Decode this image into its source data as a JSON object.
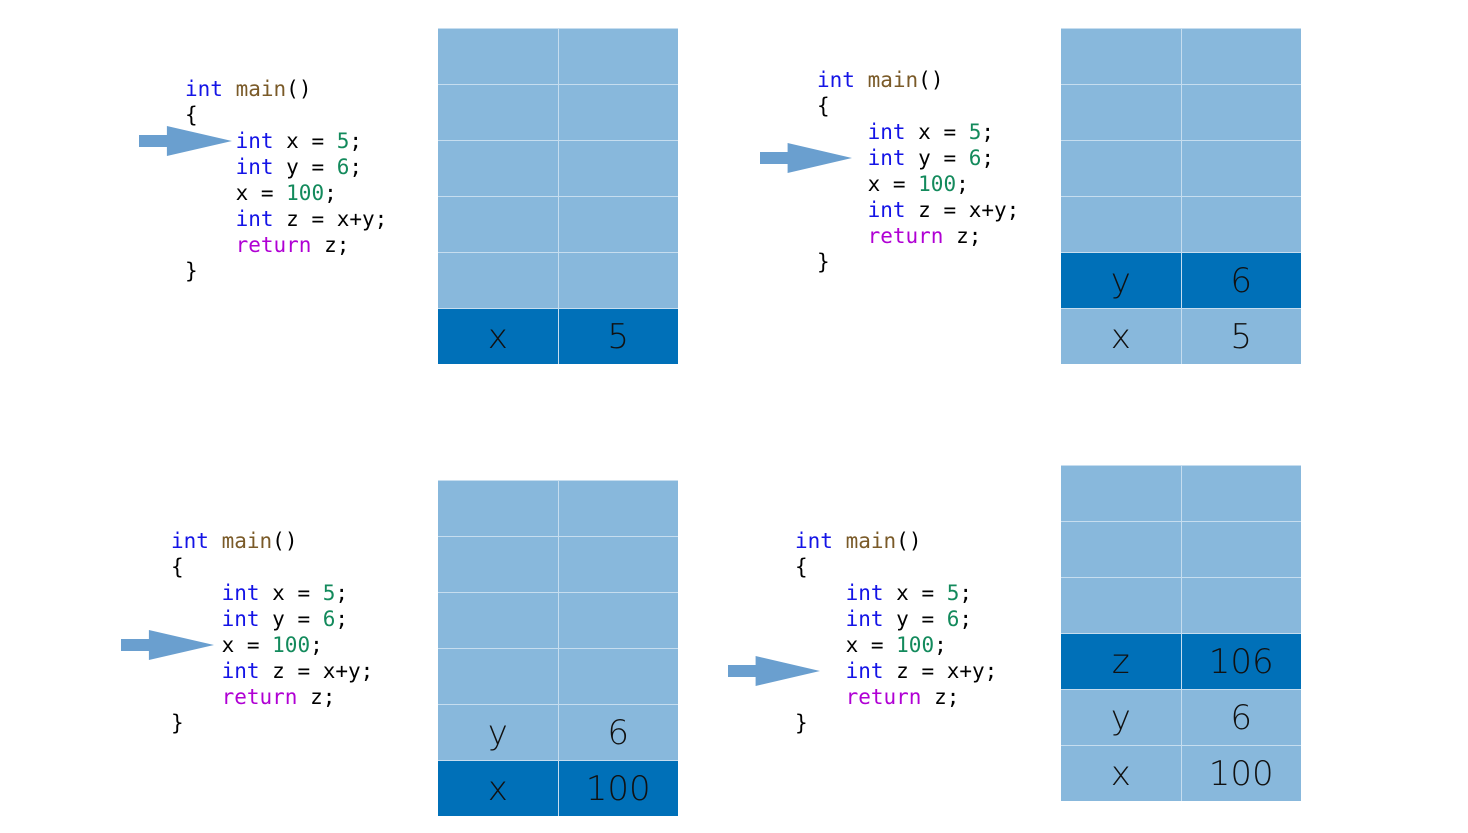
{
  "code": [
    [
      {
        "t": "int",
        "c": "kw"
      },
      {
        "t": " ",
        "c": "pl"
      },
      {
        "t": "main",
        "c": "fn"
      },
      {
        "t": "()",
        "c": "pl"
      }
    ],
    [
      {
        "t": "{",
        "c": "pl"
      }
    ],
    [
      {
        "t": "    ",
        "c": "pl"
      },
      {
        "t": "int",
        "c": "kw"
      },
      {
        "t": " x = ",
        "c": "pl"
      },
      {
        "t": "5",
        "c": "num"
      },
      {
        "t": ";",
        "c": "pl"
      }
    ],
    [
      {
        "t": "    ",
        "c": "pl"
      },
      {
        "t": "int",
        "c": "kw"
      },
      {
        "t": " y = ",
        "c": "pl"
      },
      {
        "t": "6",
        "c": "num"
      },
      {
        "t": ";",
        "c": "pl"
      }
    ],
    [
      {
        "t": "    x = ",
        "c": "pl"
      },
      {
        "t": "100",
        "c": "num"
      },
      {
        "t": ";",
        "c": "pl"
      }
    ],
    [
      {
        "t": "    ",
        "c": "pl"
      },
      {
        "t": "int",
        "c": "kw"
      },
      {
        "t": " z = x+y;",
        "c": "pl"
      }
    ],
    [
      {
        "t": "    ",
        "c": "pl"
      },
      {
        "t": "return",
        "c": "ret"
      },
      {
        "t": " z;",
        "c": "pl"
      }
    ],
    [
      {
        "t": "}",
        "c": "pl"
      }
    ]
  ],
  "colors": {
    "stack_cell": "#88b8dc",
    "stack_highlight": "#0070b8",
    "arrow": "#6a9fcf",
    "keyword": "#1414e6",
    "function": "#7a5a28",
    "number": "#138a5c",
    "return": "#b000d4"
  },
  "stack_slots": 6,
  "panels": [
    {
      "current_line": 2,
      "stack": [
        {
          "name": "x",
          "value": "5"
        }
      ],
      "highlight": 0
    },
    {
      "current_line": 3,
      "stack": [
        {
          "name": "x",
          "value": "5"
        },
        {
          "name": "y",
          "value": "6"
        }
      ],
      "highlight": 1
    },
    {
      "current_line": 4,
      "stack": [
        {
          "name": "x",
          "value": "100"
        },
        {
          "name": "y",
          "value": "6"
        }
      ],
      "highlight": 0
    },
    {
      "current_line": 5,
      "stack": [
        {
          "name": "x",
          "value": "100"
        },
        {
          "name": "y",
          "value": "6"
        },
        {
          "name": "z",
          "value": "106"
        }
      ],
      "highlight": 2
    }
  ]
}
